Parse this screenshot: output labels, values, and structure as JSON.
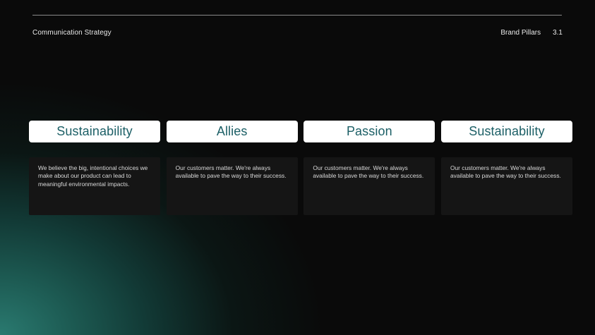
{
  "header": {
    "left_title": "Communication Strategy",
    "section_name": "Brand Pillars",
    "section_number": "3.1"
  },
  "colors": {
    "background": "#0a0a0a",
    "accent_teal": "#1c5f66",
    "glow": "#2a7a70",
    "card": "#151515"
  },
  "pillars": [
    {
      "title": "Sustainability",
      "description": "We believe the big, intentional choices we make about our product can lead to meaningful environmental impacts."
    },
    {
      "title": "Allies",
      "description": "Our customers matter. We're always available to pave the way to their success."
    },
    {
      "title": "Passion",
      "description": "Our customers matter. We're always available to pave the way to their success."
    },
    {
      "title": "Sustainability",
      "description": "Our customers matter. We're always available to pave the way to their success."
    }
  ]
}
